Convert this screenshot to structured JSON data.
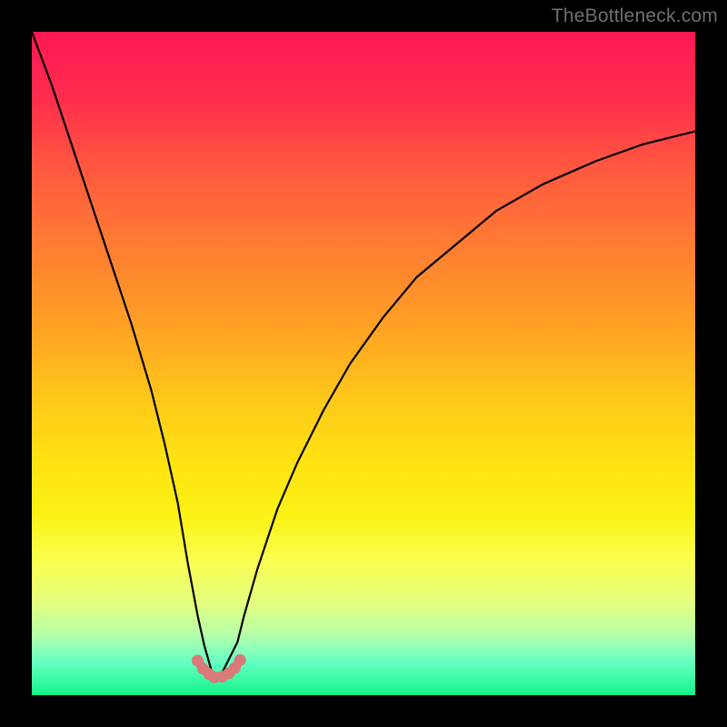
{
  "credit": "TheBottleneck.com",
  "chart_data": {
    "type": "line",
    "title": "",
    "xlabel": "",
    "ylabel": "",
    "xlim": [
      0,
      100
    ],
    "ylim": [
      0,
      100
    ],
    "grid": false,
    "series": [
      {
        "name": "bottleneck-curve",
        "x": [
          0,
          3,
          6,
          9,
          12,
          15,
          18,
          20,
          22,
          23.5,
          25,
          26,
          27,
          27.7,
          28.3,
          29,
          31,
          32,
          34,
          37,
          40,
          44,
          48,
          53,
          58,
          64,
          70,
          77,
          85,
          92,
          100
        ],
        "values": [
          100,
          92,
          83,
          74,
          65,
          56,
          46,
          38,
          29,
          20,
          12,
          7.5,
          4,
          2.5,
          2.5,
          4,
          8,
          12,
          19,
          28,
          35,
          43,
          50,
          57,
          63,
          68,
          73,
          77,
          80.5,
          83,
          85
        ]
      },
      {
        "name": "trough-markers",
        "x": [
          25.0,
          25.8,
          26.7,
          27.5,
          28.7,
          29.7,
          30.6,
          31.4
        ],
        "values": [
          5.2,
          4.0,
          3.2,
          2.7,
          2.8,
          3.3,
          4.1,
          5.3
        ]
      }
    ],
    "colors": {
      "curve": "#000000",
      "markers": "#d97a78"
    }
  }
}
